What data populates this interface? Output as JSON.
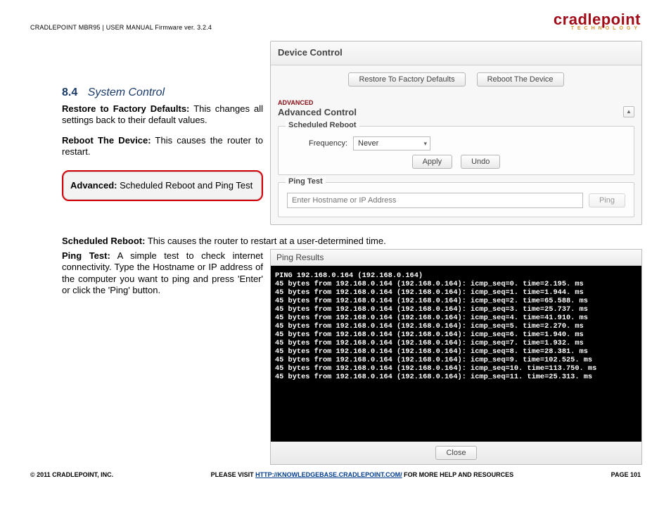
{
  "header": {
    "left": "CRADLEPOINT MBR95 | USER MANUAL Firmware ver. 3.2.4",
    "logo_main": "cradlepoint",
    "logo_sub": "TECHNOLOGY"
  },
  "section": {
    "num": "8.4",
    "name": "System Control"
  },
  "body": {
    "restore_label": "Restore to Factory Defaults:",
    "restore_text": " This changes all settings back to their default values.",
    "reboot_label": "Reboot The Device:",
    "reboot_text": " This causes the router to restart.",
    "adv_label": "Advanced:",
    "adv_text": " Scheduled Reboot and Ping Test",
    "sched_label": "Scheduled Reboot:",
    "sched_text": " This causes the router to restart at a user-determined time.",
    "ping_label": "Ping Test:",
    "ping_text": " A simple test to check internet connectivity. Type the Hostname or IP address of the computer you want to ping and press 'Enter' or click the 'Ping' button."
  },
  "ui": {
    "device_control_title": "Device Control",
    "restore_btn": "Restore To Factory Defaults",
    "reboot_btn": "Reboot The Device",
    "advanced_tag": "ADVANCED",
    "advanced_title": "Advanced Control",
    "collapse_glyph": "▲",
    "scheduled_reboot_legend": "Scheduled Reboot",
    "frequency_label": "Frequency:",
    "frequency_value": "Never",
    "apply_btn": "Apply",
    "undo_btn": "Undo",
    "ping_test_legend": "Ping Test",
    "ping_placeholder": "Enter Hostname or IP Address",
    "ping_btn": "Ping"
  },
  "ping_results": {
    "title": "Ping Results",
    "close_btn": "Close",
    "header_line": "PING 192.168.0.164 (192.168.0.164)",
    "lines": [
      "45 bytes from 192.168.0.164 (192.168.0.164): icmp_seq=0. time=2.195. ms",
      "45 bytes from 192.168.0.164 (192.168.0.164): icmp_seq=1. time=1.944. ms",
      "45 bytes from 192.168.0.164 (192.168.0.164): icmp_seq=2. time=65.588. ms",
      "45 bytes from 192.168.0.164 (192.168.0.164): icmp_seq=3. time=25.737. ms",
      "45 bytes from 192.168.0.164 (192.168.0.164): icmp_seq=4. time=41.910. ms",
      "45 bytes from 192.168.0.164 (192.168.0.164): icmp_seq=5. time=2.270. ms",
      "45 bytes from 192.168.0.164 (192.168.0.164): icmp_seq=6. time=1.940. ms",
      "45 bytes from 192.168.0.164 (192.168.0.164): icmp_seq=7. time=1.932. ms",
      "45 bytes from 192.168.0.164 (192.168.0.164): icmp_seq=8. time=28.381. ms",
      "45 bytes from 192.168.0.164 (192.168.0.164): icmp_seq=9. time=102.525. ms",
      "45 bytes from 192.168.0.164 (192.168.0.164): icmp_seq=10. time=113.750. ms",
      "45 bytes from 192.168.0.164 (192.168.0.164): icmp_seq=11. time=25.313. ms"
    ]
  },
  "footer": {
    "left": "© 2011 CRADLEPOINT, INC.",
    "center_prefix": "PLEASE VISIT ",
    "center_link": "HTTP://KNOWLEDGEBASE.CRADLEPOINT.COM/",
    "center_suffix": " FOR MORE HELP AND RESOURCES",
    "right": "PAGE 101"
  }
}
